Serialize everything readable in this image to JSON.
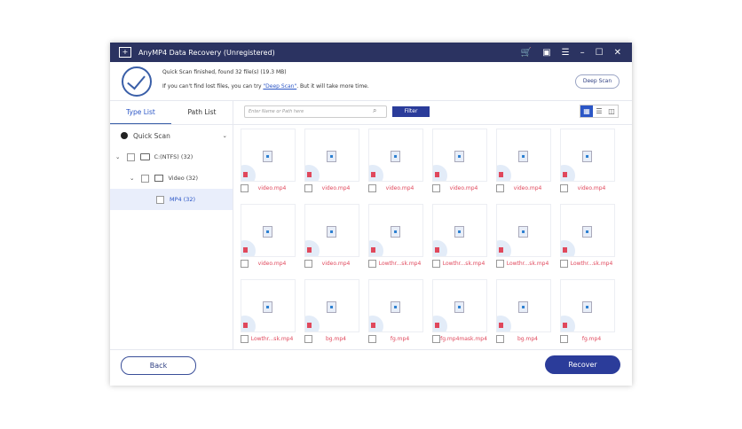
{
  "title": "AnyMP4 Data Recovery (Unregistered)",
  "header": {
    "line1": "Quick Scan finished, found 32 file(s) (19.3 MB)",
    "line2_pre": "If you can't find lost files, you can try ",
    "line2_link": "\"Deep Scan\"",
    "line2_post": ". But it will take more time.",
    "deep_scan": "Deep Scan"
  },
  "tabs": [
    "Type List",
    "Path List"
  ],
  "tree": {
    "scan": "Quick Scan",
    "drive": "C:(NTFS) (32)",
    "video": "Video (32)",
    "mp4": "MP4 (32)"
  },
  "search": {
    "placeholder": "Enter Name or Path here"
  },
  "filter": "Filter",
  "files": [
    "video.mp4",
    "video.mp4",
    "video.mp4",
    "video.mp4",
    "video.mp4",
    "video.mp4",
    "video.mp4",
    "video.mp4",
    "Lowthr...sk.mp4",
    "Lowthr...sk.mp4",
    "Lowthr...sk.mp4",
    "Lowthr...sk.mp4",
    "Lowthr...sk.mp4",
    "bg.mp4",
    "fg.mp4",
    "fg.mp4mask.mp4",
    "bg.mp4",
    "fg.mp4"
  ],
  "buttons": {
    "back": "Back",
    "recover": "Recover"
  }
}
